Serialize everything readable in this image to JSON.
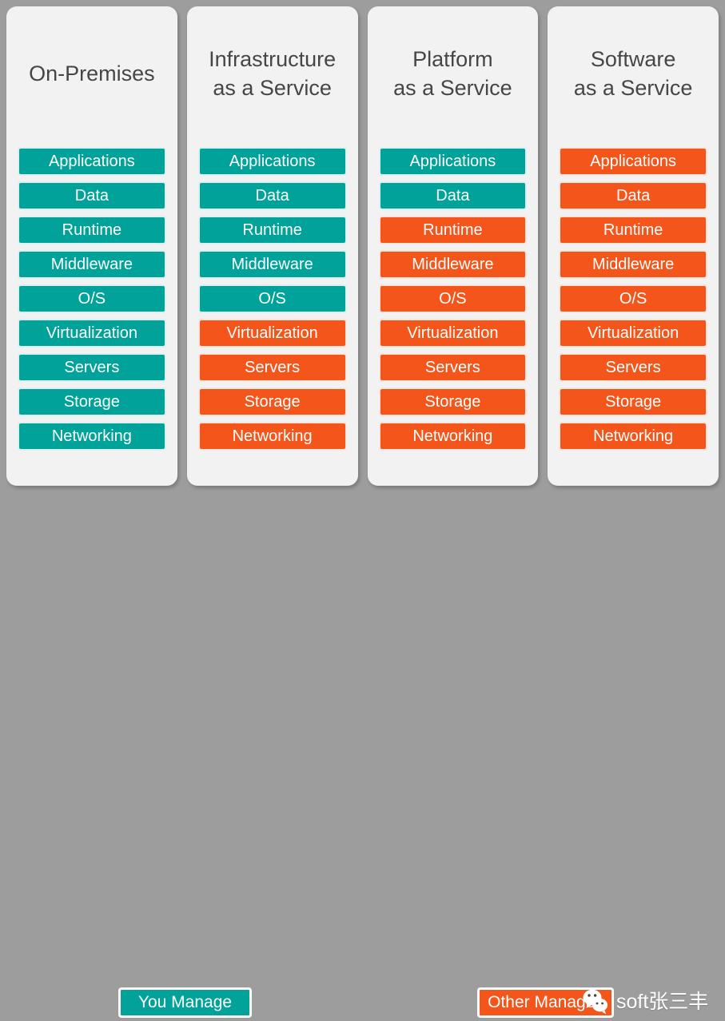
{
  "background": {
    "page_color": "#9d9d9d",
    "card_color": "#f2f2f2"
  },
  "colors": {
    "teal": "#00a29a",
    "orange": "#f4551a",
    "text_dark": "#464646",
    "text_light": "#ffffff"
  },
  "columns": [
    {
      "id": "on-premises",
      "header_line1": "On-Premises",
      "header_line2": "",
      "layers": [
        {
          "label": "Applications",
          "color": "teal"
        },
        {
          "label": "Data",
          "color": "teal"
        },
        {
          "label": "Runtime",
          "color": "teal"
        },
        {
          "label": "Middleware",
          "color": "teal"
        },
        {
          "label": "O/S",
          "color": "teal"
        },
        {
          "label": "Virtualization",
          "color": "teal"
        },
        {
          "label": "Servers",
          "color": "teal"
        },
        {
          "label": "Storage",
          "color": "teal"
        },
        {
          "label": "Networking",
          "color": "teal"
        }
      ]
    },
    {
      "id": "infrastructure-as-a-service",
      "header_line1": "Infrastructure",
      "header_line2": "as a Service",
      "layers": [
        {
          "label": "Applications",
          "color": "teal"
        },
        {
          "label": "Data",
          "color": "teal"
        },
        {
          "label": "Runtime",
          "color": "teal"
        },
        {
          "label": "Middleware",
          "color": "teal"
        },
        {
          "label": "O/S",
          "color": "teal"
        },
        {
          "label": "Virtualization",
          "color": "orange"
        },
        {
          "label": "Servers",
          "color": "orange"
        },
        {
          "label": "Storage",
          "color": "orange"
        },
        {
          "label": "Networking",
          "color": "orange"
        }
      ]
    },
    {
      "id": "platform-as-a-service",
      "header_line1": "Platform",
      "header_line2": "as a Service",
      "layers": [
        {
          "label": "Applications",
          "color": "teal"
        },
        {
          "label": "Data",
          "color": "teal"
        },
        {
          "label": "Runtime",
          "color": "orange"
        },
        {
          "label": "Middleware",
          "color": "orange"
        },
        {
          "label": "O/S",
          "color": "orange"
        },
        {
          "label": "Virtualization",
          "color": "orange"
        },
        {
          "label": "Servers",
          "color": "orange"
        },
        {
          "label": "Storage",
          "color": "orange"
        },
        {
          "label": "Networking",
          "color": "orange"
        }
      ]
    },
    {
      "id": "software-as-a-service",
      "header_line1": "Software",
      "header_line2": "as a Service",
      "layers": [
        {
          "label": "Applications",
          "color": "orange"
        },
        {
          "label": "Data",
          "color": "orange"
        },
        {
          "label": "Runtime",
          "color": "orange"
        },
        {
          "label": "Middleware",
          "color": "orange"
        },
        {
          "label": "O/S",
          "color": "orange"
        },
        {
          "label": "Virtualization",
          "color": "orange"
        },
        {
          "label": "Servers",
          "color": "orange"
        },
        {
          "label": "Storage",
          "color": "orange"
        },
        {
          "label": "Networking",
          "color": "orange"
        }
      ]
    }
  ],
  "legend": {
    "you_manage": "You Manage",
    "other_manages": "Other Manages"
  },
  "watermark": {
    "icon": "wechat-icon",
    "text": "soft张三丰"
  }
}
